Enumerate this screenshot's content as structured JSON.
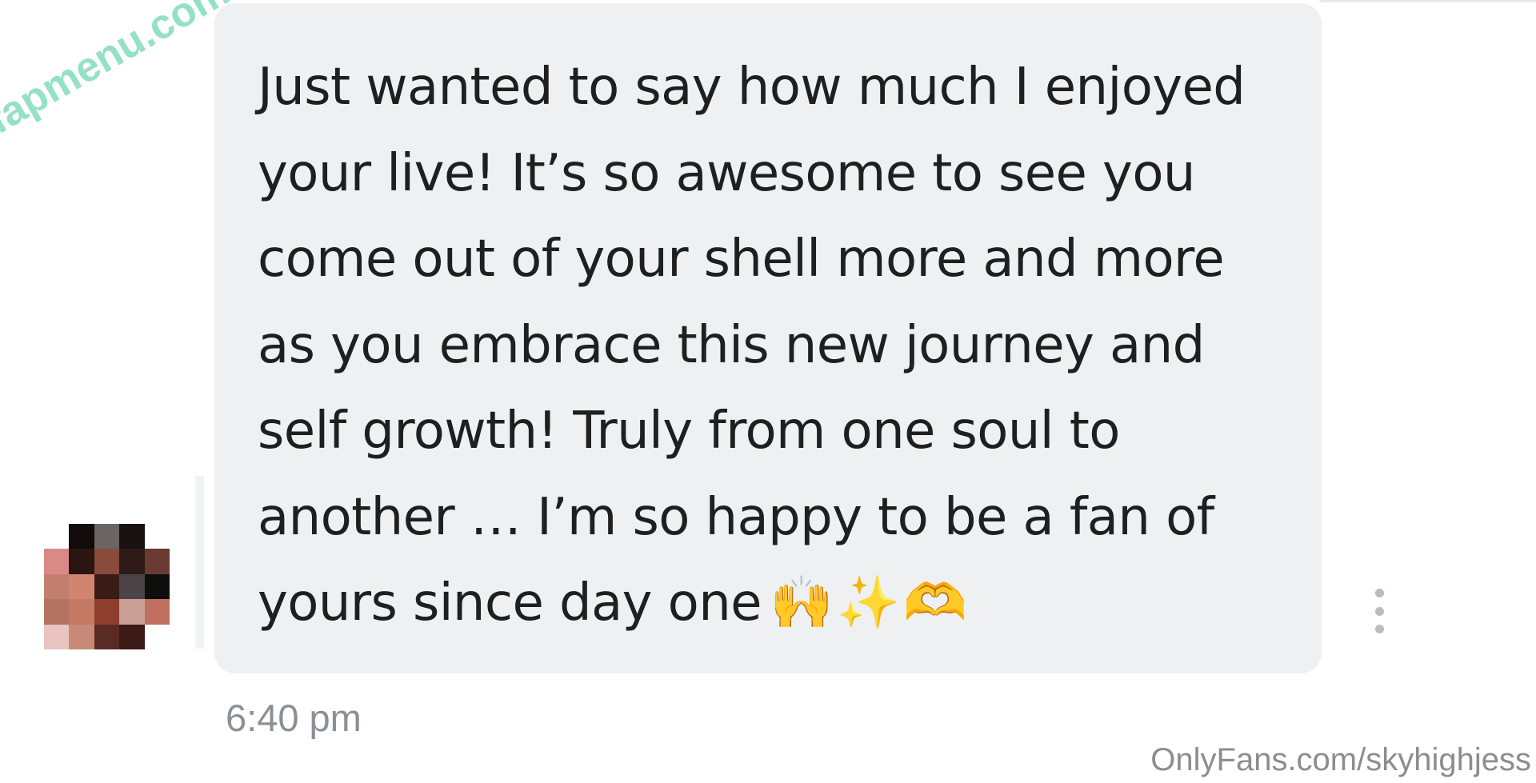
{
  "message": {
    "text": "Just wanted to say how much I enjoyed\nyour live! It’s so awesome to see you\ncome out of your shell more and more\nas you embrace this new journey and\nself growth! Truly from one soul to\nanother … I’m so happy to be a fan of\nyours since day one",
    "emoji": "🙌✨🫶",
    "timestamp": "6:40 pm"
  },
  "avatar": {
    "description_icon": "blurred-avatar",
    "pixel_colors": [
      "#ffffff",
      "#120b0b",
      "#6a6464",
      "#1a1212",
      "#ffffff",
      "#d98a86",
      "#2a1511",
      "#8a4a3c",
      "#2e1a16",
      "#6a3a33",
      "#c27e6e",
      "#d0866e",
      "#3a1c16",
      "#4a4446",
      "#0e0f0c",
      "#b47262",
      "#c47964",
      "#8e3e2c",
      "#c8a096",
      "#c07060",
      "#e9c4c0",
      "#c98978",
      "#5a2b24",
      "#3c1a16",
      "#ffffff"
    ]
  },
  "menu": {
    "icon": "kebab-menu-icon"
  },
  "watermarks": {
    "left": "fapmenu.com",
    "right": "OnlyFans.com/skyhighjess"
  },
  "colors": {
    "bubble": "#eef0f2",
    "text": "#1f1f1f",
    "timestamp": "#8a9096",
    "watermark_left": "#8fe0c4",
    "watermark_right": "#8d8d8d"
  }
}
